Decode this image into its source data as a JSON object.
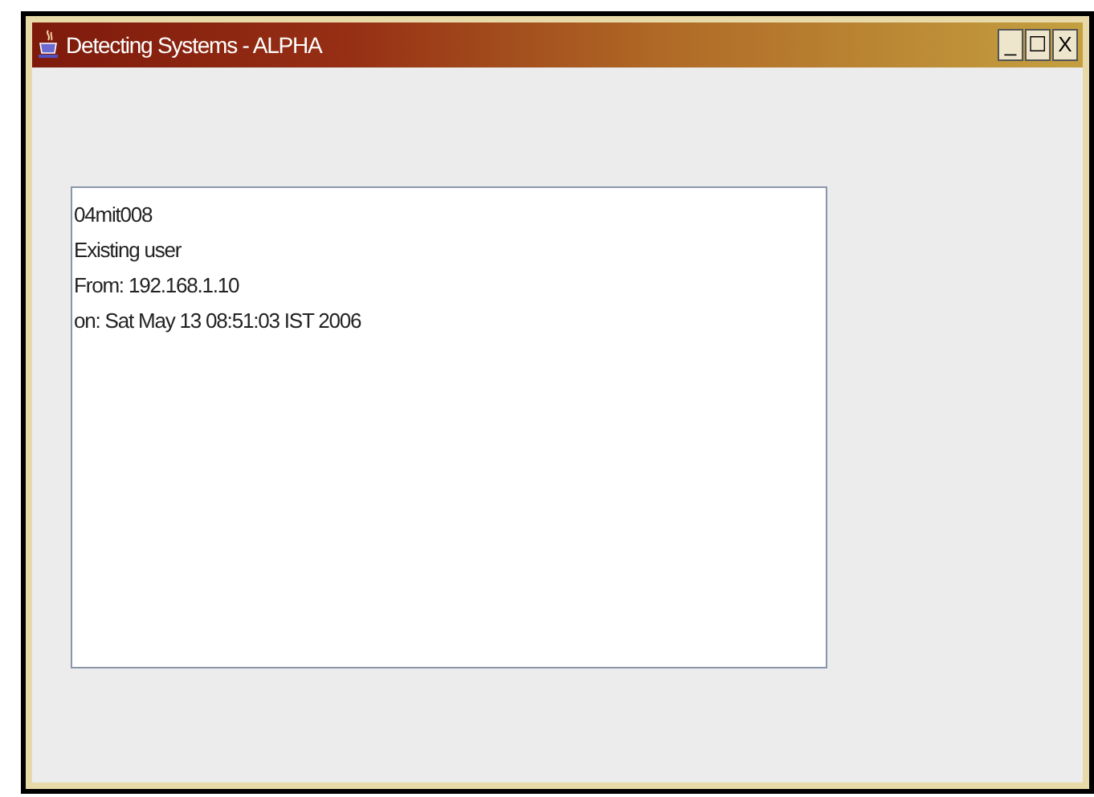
{
  "window": {
    "title": "Detecting Systems - ALPHA",
    "controls": [
      "_",
      "☐",
      "X"
    ]
  },
  "text_area": {
    "lines": [
      "04mit008",
      "Existing user",
      "From: 192.168.1.10",
      "on: Sat May 13 08:51:03 IST 2006"
    ]
  }
}
